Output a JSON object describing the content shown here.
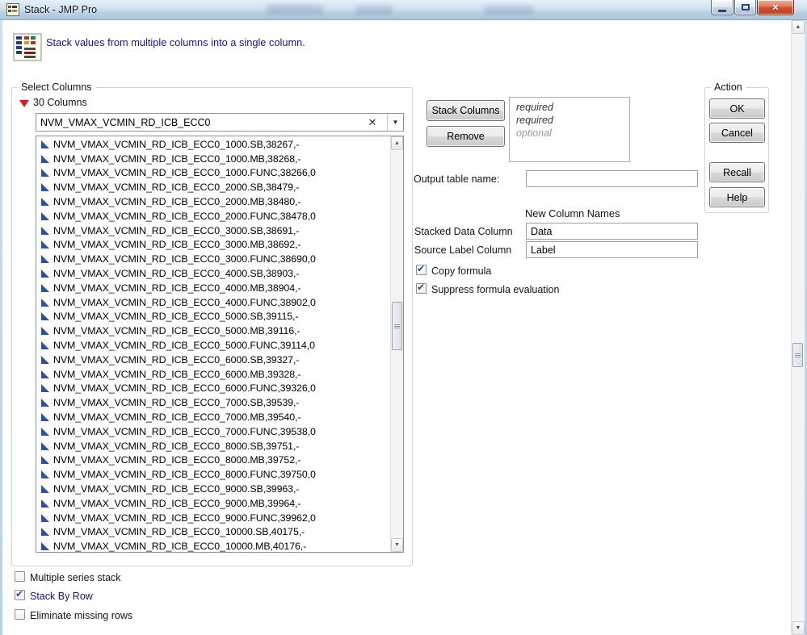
{
  "window": {
    "title": "Stack - JMP Pro"
  },
  "icons": {
    "clear_glyph": "✕",
    "dropdown_glyph": "▼",
    "scroll_up_glyph": "▲",
    "scroll_down_glyph": "▼",
    "close_glyph": "✕"
  },
  "header": {
    "description": "Stack values from multiple columns into a single column."
  },
  "select_columns": {
    "group_label": "Select Columns",
    "count_label": "30 Columns",
    "filter_value": "NVM_VMAX_VCMIN_RD_ICB_ECC0",
    "items": [
      "NVM_VMAX_VCMIN_RD_ICB_ECC0_1000.SB,38267,-",
      "NVM_VMAX_VCMIN_RD_ICB_ECC0_1000.MB,38268,-",
      "NVM_VMAX_VCMIN_RD_ICB_ECC0_1000.FUNC,38266,0",
      "NVM_VMAX_VCMIN_RD_ICB_ECC0_2000.SB,38479,-",
      "NVM_VMAX_VCMIN_RD_ICB_ECC0_2000.MB,38480,-",
      "NVM_VMAX_VCMIN_RD_ICB_ECC0_2000.FUNC,38478,0",
      "NVM_VMAX_VCMIN_RD_ICB_ECC0_3000.SB,38691,-",
      "NVM_VMAX_VCMIN_RD_ICB_ECC0_3000.MB,38692,-",
      "NVM_VMAX_VCMIN_RD_ICB_ECC0_3000.FUNC,38690,0",
      "NVM_VMAX_VCMIN_RD_ICB_ECC0_4000.SB,38903,-",
      "NVM_VMAX_VCMIN_RD_ICB_ECC0_4000.MB,38904,-",
      "NVM_VMAX_VCMIN_RD_ICB_ECC0_4000.FUNC,38902,0",
      "NVM_VMAX_VCMIN_RD_ICB_ECC0_5000.SB,39115,-",
      "NVM_VMAX_VCMIN_RD_ICB_ECC0_5000.MB,39116,-",
      "NVM_VMAX_VCMIN_RD_ICB_ECC0_5000.FUNC,39114,0",
      "NVM_VMAX_VCMIN_RD_ICB_ECC0_6000.SB,39327,-",
      "NVM_VMAX_VCMIN_RD_ICB_ECC0_6000.MB,39328,-",
      "NVM_VMAX_VCMIN_RD_ICB_ECC0_6000.FUNC,39326,0",
      "NVM_VMAX_VCMIN_RD_ICB_ECC0_7000.SB,39539,-",
      "NVM_VMAX_VCMIN_RD_ICB_ECC0_7000.MB,39540,-",
      "NVM_VMAX_VCMIN_RD_ICB_ECC0_7000.FUNC,39538,0",
      "NVM_VMAX_VCMIN_RD_ICB_ECC0_8000.SB,39751,-",
      "NVM_VMAX_VCMIN_RD_ICB_ECC0_8000.MB,39752,-",
      "NVM_VMAX_VCMIN_RD_ICB_ECC0_8000.FUNC,39750,0",
      "NVM_VMAX_VCMIN_RD_ICB_ECC0_9000.SB,39963,-",
      "NVM_VMAX_VCMIN_RD_ICB_ECC0_9000.MB,39964,-",
      "NVM_VMAX_VCMIN_RD_ICB_ECC0_9000.FUNC,39962,0",
      "NVM_VMAX_VCMIN_RD_ICB_ECC0_10000.SB,40175,-",
      "NVM_VMAX_VCMIN_RD_ICB_ECC0_10000.MB,40176,-"
    ]
  },
  "cast_panel": {
    "stack_columns_button": "Stack Columns",
    "remove_button": "Remove",
    "drop_slots": [
      "required",
      "required",
      "optional"
    ]
  },
  "output": {
    "table_name_label": "Output table name:",
    "table_name_value": "",
    "new_column_names_heading": "New Column Names",
    "stacked_data_column_label": "Stacked Data Column",
    "stacked_data_column_value": "Data",
    "source_label_column_label": "Source Label Column",
    "source_label_column_value": "Label"
  },
  "checkboxes": {
    "copy_formula": {
      "label": "Copy formula",
      "checked": true
    },
    "suppress_formula_evaluation": {
      "label": "Suppress formula evaluation",
      "checked": true
    },
    "multiple_series_stack": {
      "label": "Multiple series stack",
      "checked": false
    },
    "stack_by_row": {
      "label": "Stack By Row",
      "checked": true
    },
    "eliminate_missing_rows": {
      "label": "Eliminate missing rows",
      "checked": false
    }
  },
  "action": {
    "group_label": "Action",
    "ok": "OK",
    "cancel": "Cancel",
    "recall": "Recall",
    "help": "Help"
  },
  "colors": {
    "titlebar": "#c3d8ec",
    "close_button": "#c6492c",
    "red_triangle": "#c82121",
    "column_icon_blue": "#2a52a0",
    "description_text": "#18187a"
  }
}
